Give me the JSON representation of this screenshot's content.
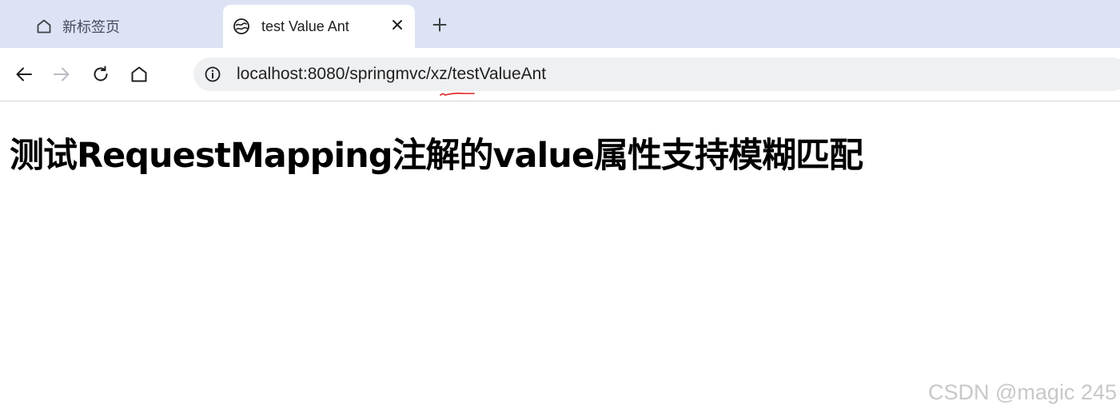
{
  "browser": {
    "tabs": [
      {
        "title": "新标签页",
        "icon": "home-icon",
        "active": false
      },
      {
        "title": "test Value Ant",
        "icon": "favicon-globe-icon",
        "active": true,
        "close_icon": "close-icon"
      }
    ],
    "new_tab_icon": "plus-icon",
    "toolbar": {
      "back_icon": "arrow-left-icon",
      "forward_icon": "arrow-right-icon",
      "reload_icon": "reload-icon",
      "home_icon": "home-icon"
    },
    "address_bar": {
      "site_info_icon": "info-icon",
      "url": "localhost:8080/springmvc/xz/testValueAnt"
    }
  },
  "page": {
    "heading": "测试RequestMapping注解的value属性支持模糊匹配"
  },
  "watermark": "CSDN @magic 245",
  "colors": {
    "tabstrip_bg": "#dde3f5",
    "omnibox_bg": "#eff0f2",
    "heading_color": "#000000",
    "watermark_color": "#c8c8c8",
    "spellcheck_squiggle": "#e02020"
  }
}
